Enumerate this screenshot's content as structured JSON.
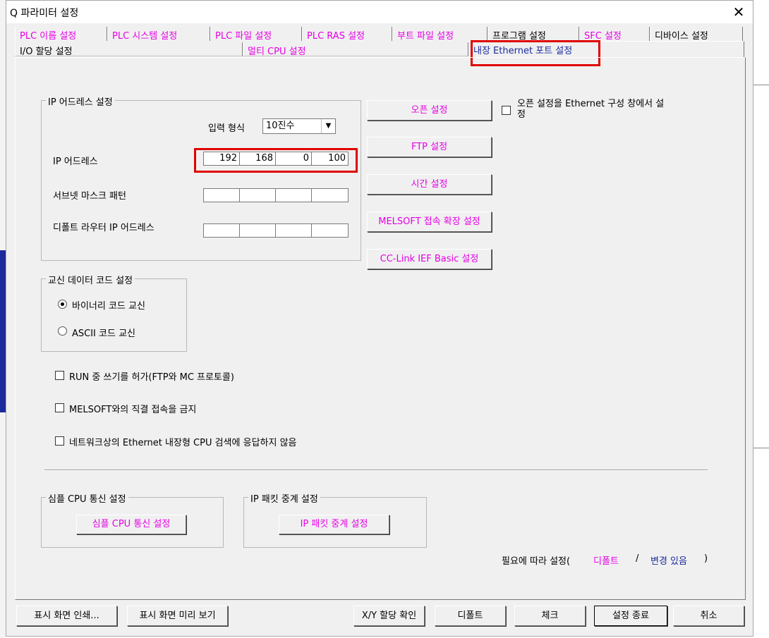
{
  "window": {
    "title": "Q 파라미터 설정",
    "close_glyph": "✕"
  },
  "tabs_row1": [
    {
      "label": "PLC 이름 설정",
      "color": "#e600e6"
    },
    {
      "label": "PLC 시스템 설정",
      "color": "#e600e6"
    },
    {
      "label": "PLC 파일 설정",
      "color": "#e600e6"
    },
    {
      "label": "PLC RAS 설정",
      "color": "#e600e6"
    },
    {
      "label": "부트 파일 설정",
      "color": "#e600e6"
    },
    {
      "label": "프로그램 설정",
      "color": "#000000"
    },
    {
      "label": "SFC 설정",
      "color": "#e600e6"
    },
    {
      "label": "디바이스 설정",
      "color": "#000000"
    }
  ],
  "tabs_row2": [
    {
      "label": "I/O 할당 설정"
    },
    {
      "label": "멀티 CPU 설정"
    },
    {
      "label": "내장 Ethernet 포트 설정",
      "selected": true
    }
  ],
  "ip_group": {
    "legend": "IP 어드레스 설정",
    "input_format_label": "입력 형식",
    "input_format_value": "10진수",
    "ip_label": "IP 어드레스",
    "ip_octets": [
      "192",
      "168",
      "0",
      "100"
    ],
    "subnet_label": "서브넷 마스크 패턴",
    "subnet_octets": [
      "",
      "",
      "",
      ""
    ],
    "gateway_label": "디폴트 라우터 IP 어드레스",
    "gateway_octets": [
      "",
      "",
      "",
      ""
    ]
  },
  "side_buttons": {
    "open": "오픈 설정",
    "ftp": "FTP 설정",
    "time": "시간 설정",
    "melsoft": "MELSOFT 접속 확장 설정",
    "cclink": "CC-Link IEF Basic 설정"
  },
  "open_setting_check": {
    "label": "오픈 설정을 Ethernet 구성 창에서 설정",
    "checked": false
  },
  "comm_code": {
    "legend": "교신 데이터 코드 설정",
    "binary": "바이너리 코드 교신",
    "ascii": "ASCII 코드 교신",
    "selected": "binary"
  },
  "checkboxes": {
    "run_write": {
      "label": "RUN 중 쓰기를 허가(FTP와 MC 프로토콜)",
      "checked": false
    },
    "melsoft_direct": {
      "label": "MELSOFT와의 직결 접속을 금지",
      "checked": false
    },
    "no_search": {
      "label": "네트워크상의 Ethernet 내장형 CPU 검색에 응답하지 않음",
      "checked": false
    }
  },
  "simple_cpu": {
    "legend": "심플 CPU 통신 설정",
    "button": "심플 CPU 통신 설정"
  },
  "ip_packet": {
    "legend": "IP 패킷 중계 설정",
    "button": "IP 패킷 중계 설정"
  },
  "legend_note": {
    "prefix": "필요에 따라 설정(",
    "default_text": "디폴트",
    "slash": "/",
    "changed_text": "변경 있음",
    "suffix": ")",
    "default_color": "#e600e6",
    "changed_color": "#1a2a9e"
  },
  "bottom_buttons": {
    "print": "표시 화면 인쇄...",
    "preview": "표시 화면 미리 보기",
    "xy_check": "X/Y 할당 확인",
    "default": "디폴트",
    "check": "체크",
    "finish": "설정 종료",
    "cancel": "취소"
  }
}
